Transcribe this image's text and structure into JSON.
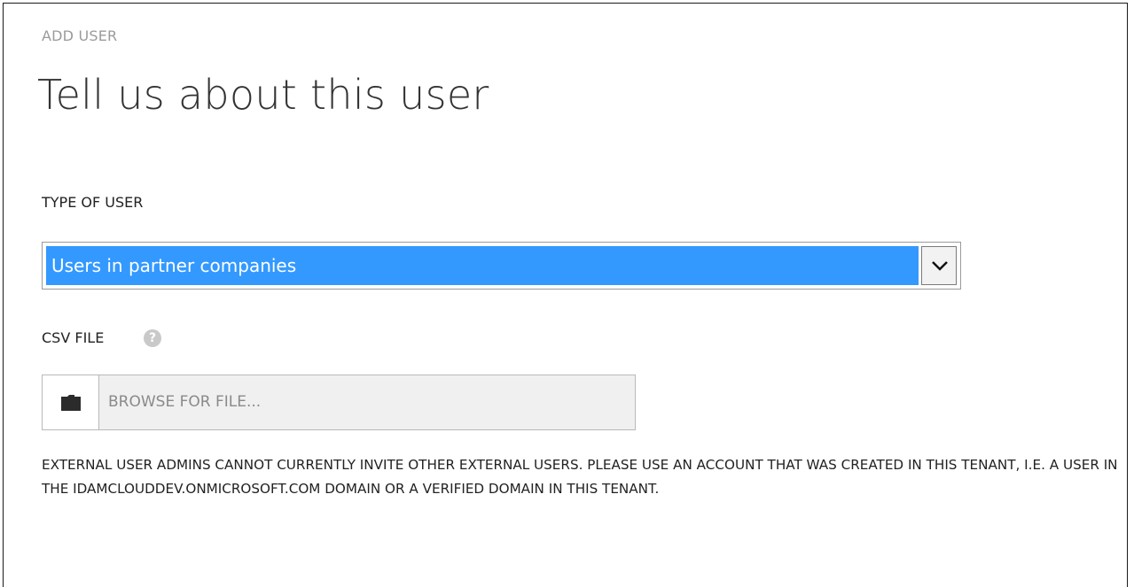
{
  "wizard": {
    "step_label": "ADD USER",
    "title": "Tell us about this user"
  },
  "type_of_user": {
    "label": "TYPE OF USER",
    "selected_value": "Users in partner companies",
    "arrow_icon": "chevron-down-icon"
  },
  "csv_file": {
    "label": "CSV FILE",
    "help_icon": "help-icon",
    "help_glyph": "?",
    "browse_icon": "folder-icon",
    "browse_placeholder": "BROWSE FOR FILE..."
  },
  "notice": {
    "text": "EXTERNAL USER ADMINS CANNOT CURRENTLY INVITE OTHER EXTERNAL USERS. PLEASE USE AN ACCOUNT THAT WAS CREATED IN THIS TENANT, I.E. A USER IN THE IDAMCLOUDDEV.ONMICROSOFT.COM DOMAIN OR A VERIFIED DOMAIN IN THIS TENANT."
  },
  "colors": {
    "selection_highlight": "#3399ff",
    "muted_text": "#9b9b9b",
    "field_background": "#f0f0f0"
  }
}
